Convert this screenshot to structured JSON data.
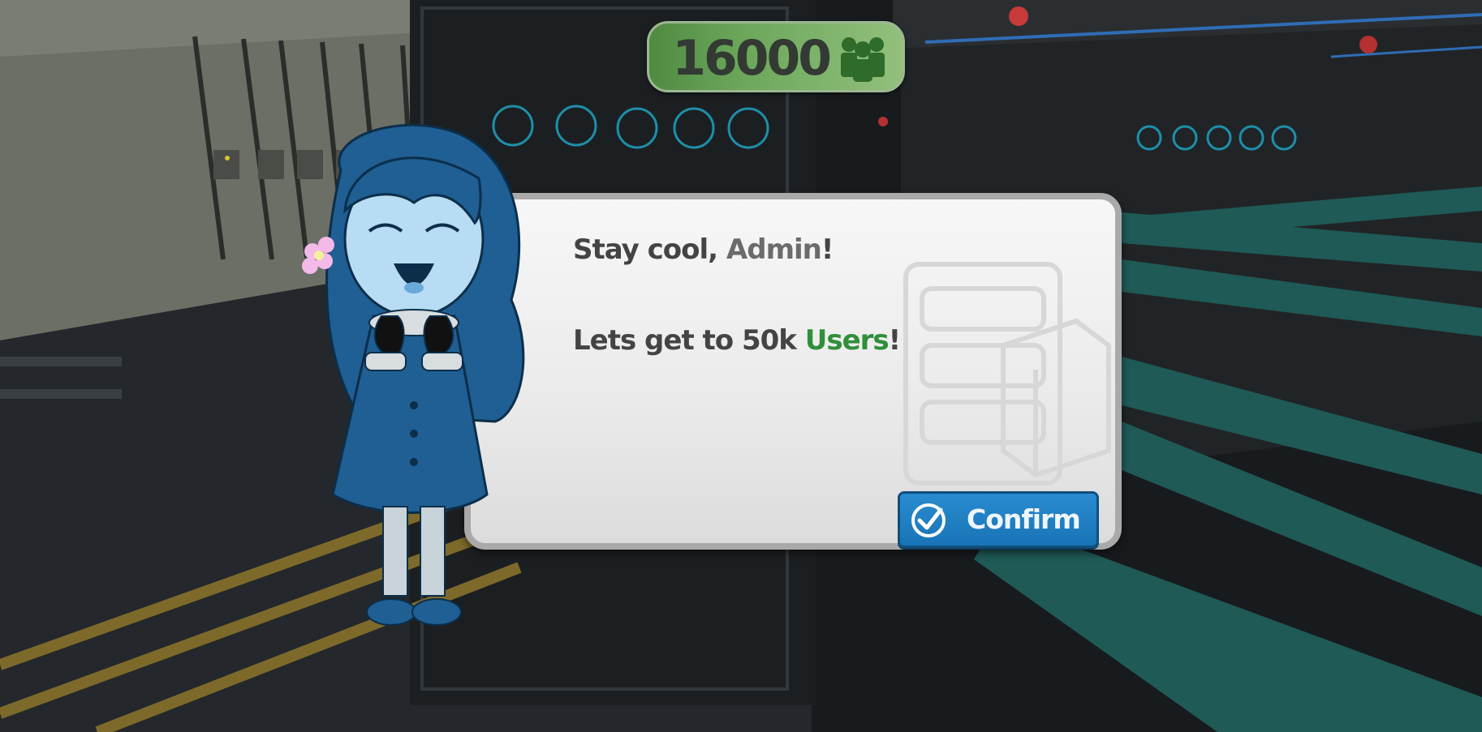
{
  "hud": {
    "user_count": "16000",
    "user_icon": "users-icon"
  },
  "dialog": {
    "line1_prefix": "Stay cool, ",
    "line1_name": "Admin",
    "line1_suffix": "!",
    "line2_prefix": "Lets get to 50k ",
    "line2_highlight": "Users",
    "line2_suffix": "!",
    "confirm_label": "Confirm",
    "confirm_icon": "checkmark-icon"
  },
  "colors": {
    "accent_green": "#2f8f3a",
    "button_blue": "#1874b6",
    "hud_green": "#6aa65a",
    "character_blue": "#1f5f93"
  }
}
